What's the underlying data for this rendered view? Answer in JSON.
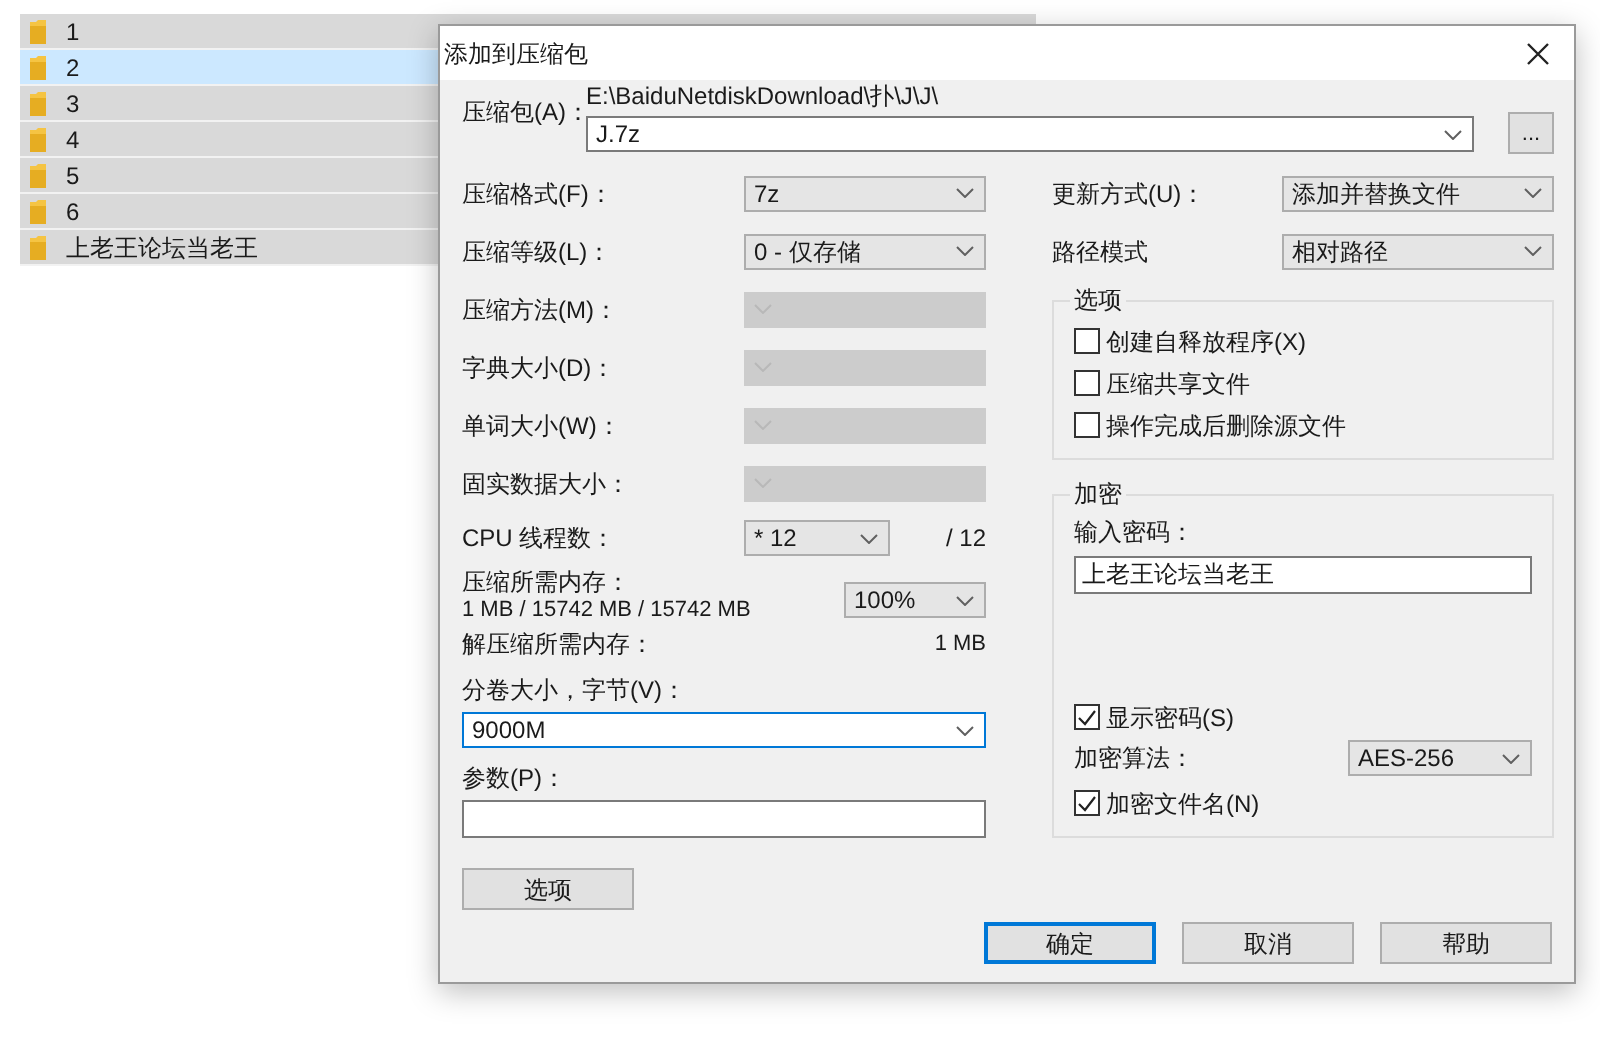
{
  "file_list": {
    "rows": [
      {
        "name": "1",
        "selected": false
      },
      {
        "name": "2",
        "selected": true
      },
      {
        "name": "3",
        "selected": false
      },
      {
        "name": "4",
        "selected": false
      },
      {
        "name": "5",
        "selected": false
      },
      {
        "name": "6",
        "selected": false
      },
      {
        "name": "上老王论坛当老王",
        "selected": false
      }
    ]
  },
  "dialog": {
    "title": "添加到压缩包",
    "archive": {
      "label": "压缩包(A)：",
      "path": "E:\\BaiduNetdiskDownload\\扑\\J\\J\\",
      "value": "J.7z",
      "browse": "..."
    },
    "left_fields": [
      {
        "label": "压缩格式(F)：",
        "value": "7z",
        "disabled": false
      },
      {
        "label": "压缩等级(L)：",
        "value": "0 - 仅存储",
        "disabled": false
      },
      {
        "label": "压缩方法(M)：",
        "disabled": true
      },
      {
        "label": "字典大小(D)：",
        "disabled": true
      },
      {
        "label": "单词大小(W)：",
        "disabled": true
      },
      {
        "label": "固实数据大小：",
        "disabled": true
      }
    ],
    "cpu": {
      "label": "CPU 线程数：",
      "value": "* 12",
      "total": "/ 12"
    },
    "memory": {
      "label": "压缩所需内存：",
      "detail": "1 MB / 15742 MB / 15742 MB",
      "value": "100%"
    },
    "decompress": {
      "label": "解压缩所需内存：",
      "value": "1 MB"
    },
    "volume": {
      "label": "分卷大小，字节(V)：",
      "value": "9000M",
      "focused": true
    },
    "params": {
      "label": "参数(P)："
    },
    "options_button": "选项",
    "update": {
      "label": "更新方式(U)：",
      "value": "添加并替换文件"
    },
    "path_mode": {
      "label": "路径模式",
      "value": "相对路径"
    },
    "options_group": {
      "title": "选项",
      "items": [
        {
          "label": "创建自释放程序(X)",
          "checked": false
        },
        {
          "label": "压缩共享文件",
          "checked": false
        },
        {
          "label": "操作完成后删除源文件",
          "checked": false
        }
      ]
    },
    "encryption": {
      "title": "加密",
      "password_label": "输入密码：",
      "password": "上老王论坛当老王",
      "show_password": {
        "label": "显示密码(S)",
        "checked": true
      },
      "method_label": "加密算法：",
      "method": "AES-256",
      "encrypt_names": {
        "label": "加密文件名(N)",
        "checked": true
      }
    },
    "buttons": [
      {
        "label": "确定",
        "default": true
      },
      {
        "label": "取消",
        "default": false
      },
      {
        "label": "帮助",
        "default": false
      }
    ]
  }
}
